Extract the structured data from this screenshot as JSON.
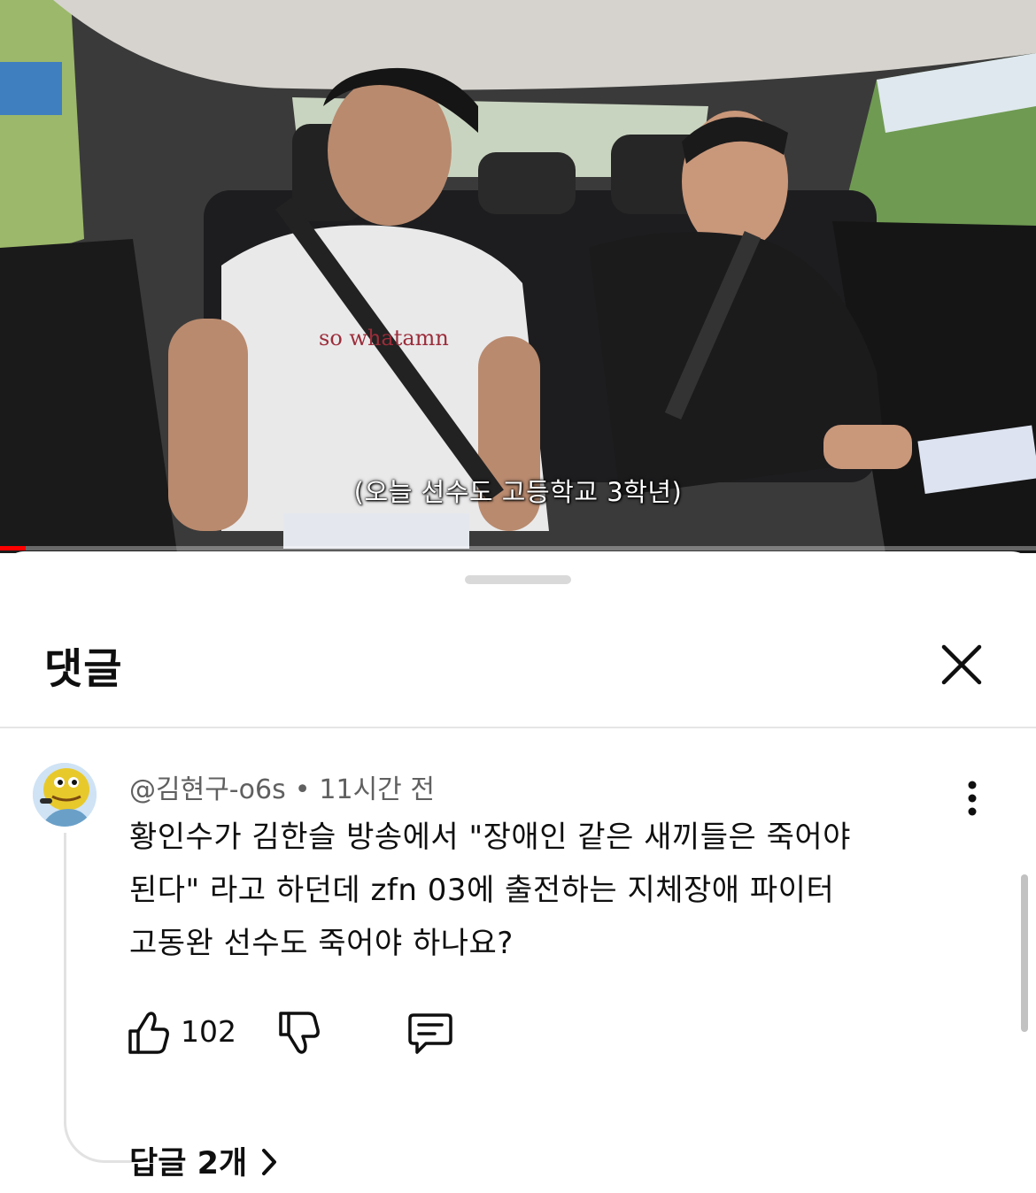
{
  "video": {
    "subtitle": "(오늘 선수도 고등학교 3학년)",
    "progress": 0.025
  },
  "sheet": {
    "title": "댓글"
  },
  "comment": {
    "author": "@김현구-o6s",
    "separator": "•",
    "time": "11시간 전",
    "lines": [
      "황인수가 김한슬 방송에서 \"장애인 같은 새끼들은 죽어야",
      "된다\" 라고 하던데 zfn 03에 출전하는 지체장애 파이터",
      "고동완 선수도 죽어야 하나요?"
    ],
    "likes": "102",
    "replies_label": "답글 2개"
  },
  "icons": {
    "close": "close-icon",
    "more": "more-vert-icon",
    "like": "thumb-up-icon",
    "dislike": "thumb-down-icon",
    "reply": "comment-icon",
    "chevron": "chevron-right-icon"
  },
  "colors": {
    "progress": "#ff0000",
    "text": "#0f0f0f",
    "secondary": "#606060"
  }
}
